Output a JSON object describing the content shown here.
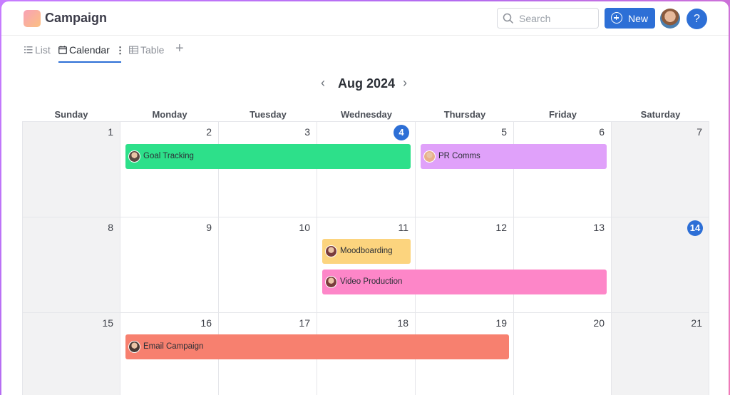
{
  "app": {
    "title": "Campaign"
  },
  "header": {
    "search_placeholder": "Search",
    "new_label": "New",
    "help_label": "?"
  },
  "views": {
    "list": "List",
    "calendar": "Calendar",
    "calendar_menu": "⋮",
    "table": "Table",
    "add": "+"
  },
  "calendar": {
    "month_label": "Aug 2024",
    "prev": "‹",
    "next": "›",
    "weekdays": [
      "Sunday",
      "Monday",
      "Tuesday",
      "Wednesday",
      "Thursday",
      "Friday",
      "Saturday"
    ],
    "weeks": [
      [
        "1",
        "2",
        "3",
        "4",
        "5",
        "6",
        "7"
      ],
      [
        "8",
        "9",
        "10",
        "11",
        "12",
        "13",
        "14"
      ],
      [
        "15",
        "16",
        "17",
        "18",
        "19",
        "20",
        "21"
      ]
    ],
    "highlighted_days": [
      "4",
      "14"
    ],
    "highlight_color": "#2d6fd6"
  },
  "events": [
    {
      "label": "Goal Tracking",
      "color": "#2de08a",
      "avatar_color": "#5b4a42"
    },
    {
      "label": "PR Comms",
      "color": "#e0a1fa",
      "avatar_color": "#e8b08a"
    },
    {
      "label": "Moodboarding",
      "color": "#fcd47e",
      "avatar_color": "#7a3c3c"
    },
    {
      "label": "Video Production",
      "color": "#fd86c8",
      "avatar_color": "#7a3c3c"
    },
    {
      "label": "Email Campaign",
      "color": "#f7806f",
      "avatar_color": "#4a3a34"
    }
  ],
  "colors": {
    "accent": "#2d6fd6"
  }
}
